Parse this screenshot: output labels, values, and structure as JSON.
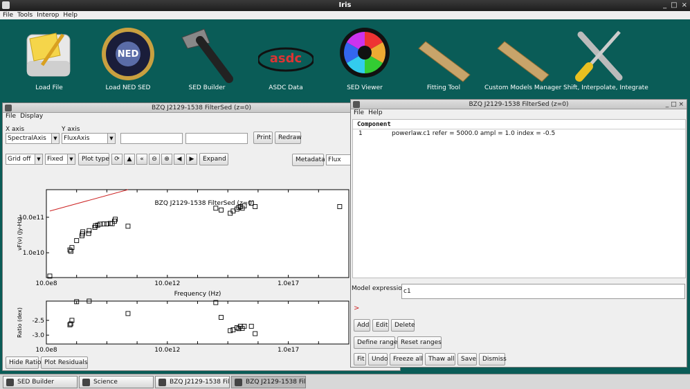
{
  "app": {
    "title": "Iris",
    "menus": [
      "File",
      "Tools",
      "Interop",
      "Help"
    ],
    "win_controls": [
      "_",
      "□",
      "×"
    ]
  },
  "tools": [
    {
      "label": "Load File",
      "icon": "load-file-icon"
    },
    {
      "label": "Load NED SED",
      "icon": "ned-icon"
    },
    {
      "label": "SED Builder",
      "icon": "hammer-icon"
    },
    {
      "label": "ASDC Data",
      "icon": "asdc-icon"
    },
    {
      "label": "SED Viewer",
      "icon": "color-wheel-icon"
    },
    {
      "label": "Fitting Tool",
      "icon": "ruler-icon"
    },
    {
      "label": "Custom Models Manager",
      "icon": "ruler-icon"
    },
    {
      "label": "Shift, Interpolate, Integrate",
      "icon": "wrench-screwdriver-icon"
    }
  ],
  "viewer": {
    "title": "BZQ J2129-1538 FilterSed (z=0)",
    "menus": [
      "File",
      "Display"
    ],
    "x_axis_label": "X axis",
    "y_axis_label": "Y axis",
    "x_axis_value": "SpectralAxis",
    "y_axis_value": "FluxAxis",
    "print": "Print",
    "redraw": "Redraw",
    "grid": "Grid off",
    "scale": "Fixed",
    "plot_type": "Plot type",
    "expand": "Expand",
    "metadata": "Metadata",
    "flux_field": "Flux",
    "hide_ratio": "Hide Ratio",
    "plot_residuals": "Plot Residuals"
  },
  "chart_data": [
    {
      "type": "scatter",
      "title": "BZQ J2129-1538 FilterSed (z=0)",
      "xlabel": "Frequency (Hz)",
      "ylabel": "νF(ν) (Jy-Hz)",
      "xscale": "log",
      "yscale": "log",
      "x_tick_labels": [
        "10.0e8",
        "10.0e12",
        "1.0e17"
      ],
      "y_tick_labels": [
        "10.0e11",
        "1.0e10"
      ],
      "xlim": [
        1000000000.0,
        1e+19
      ],
      "ylim": [
        2000000000.0,
        600000000000.0
      ],
      "series": [
        {
          "name": "",
          "marker": "square",
          "color": "#000000",
          "points": [
            [
              1300000000.0,
              2200000000.0
            ],
            [
              6000000000.0,
              12000000000.0
            ],
            [
              6500000000.0,
              11000000000.0
            ],
            [
              7000000000.0,
              14000000000.0
            ],
            [
              10000000000.0,
              22000000000.0
            ],
            [
              15000000000.0,
              30000000000.0
            ],
            [
              15500000000.0,
              34000000000.0
            ],
            [
              16000000000.0,
              39000000000.0
            ],
            [
              25000000000.0,
              35000000000.0
            ],
            [
              26000000000.0,
              42000000000.0
            ],
            [
              40000000000.0,
              52000000000.0
            ],
            [
              42000000000.0,
              58000000000.0
            ],
            [
              50000000000.0,
              60000000000.0
            ],
            [
              60000000000.0,
              64000000000.0
            ],
            [
              80000000000.0,
              65000000000.0
            ],
            [
              100000000000.0,
              65000000000.0
            ],
            [
              130000000000.0,
              67000000000.0
            ],
            [
              150000000000.0,
              66000000000.0
            ],
            [
              180000000000.0,
              78000000000.0
            ],
            [
              190000000000.0,
              88000000000.0
            ],
            [
              500000000000.0,
              56000000000.0
            ],
            [
              400000000000000.0,
              180000000000.0
            ],
            [
              600000000000000.0,
              160000000000.0
            ],
            [
              1200000000000000.0,
              130000000000.0
            ],
            [
              1500000000000000.0,
              150000000000.0
            ],
            [
              2000000000000000.0,
              170000000000.0
            ],
            [
              2300000000000000.0,
              190000000000.0
            ],
            [
              2600000000000000.0,
              200000000000.0
            ],
            [
              3000000000000000.0,
              180000000000.0
            ],
            [
              3500000000000000.0,
              210000000000.0
            ],
            [
              6000000000000000.0,
              250000000000.0
            ],
            [
              8000000000000000.0,
              200000000000.0
            ],
            [
              5e+18,
              200000000000.0
            ]
          ]
        },
        {
          "name": "",
          "type": "line",
          "color": "#cc2222",
          "points": [
            [
              1300000000.0,
              150000000000.0
            ],
            [
              500000000000.0,
              600000000000.0
            ]
          ]
        }
      ]
    },
    {
      "type": "scatter",
      "xlabel": "",
      "ylabel": "Ratio (dex)",
      "xscale": "log",
      "x_tick_labels": [
        "10.0e8",
        "10.0e12",
        "1.0e17"
      ],
      "y_tick_labels": [
        "-2.5",
        "-3.0"
      ],
      "xlim": [
        1000000000.0,
        1e+19
      ],
      "ylim": [
        -3.3,
        -1.85
      ],
      "series": [
        {
          "name": "",
          "marker": "square",
          "color": "#000000",
          "points": [
            [
              6000000000.0,
              -2.65
            ],
            [
              6400000000.0,
              -2.62
            ],
            [
              7000000000.0,
              -2.5
            ],
            [
              10000000000.0,
              -1.87
            ],
            [
              26000000000.0,
              -1.85
            ],
            [
              500000000000.0,
              -2.27
            ],
            [
              400000000000000.0,
              -1.9
            ],
            [
              600000000000000.0,
              -2.4
            ],
            [
              1200000000000000.0,
              -2.85
            ],
            [
              1500000000000000.0,
              -2.82
            ],
            [
              2000000000000000.0,
              -2.75
            ],
            [
              2300000000000000.0,
              -2.78
            ],
            [
              2600000000000000.0,
              -2.7
            ],
            [
              3000000000000000.0,
              -2.77
            ],
            [
              3500000000000000.0,
              -2.7
            ],
            [
              6000000000000000.0,
              -2.7
            ],
            [
              8000000000000000.0,
              -2.95
            ]
          ]
        }
      ]
    }
  ],
  "fit": {
    "title": "BZQ J2129-1538 FilterSed (z=0)",
    "menus": [
      "File",
      "Help"
    ],
    "component_header": "Component",
    "component_row": {
      "id": "1",
      "text": "powerlaw.c1   refer = 5000.0 ampl = 1.0 index = -0.5"
    },
    "model_expression_label": "Model expression",
    "model_expression": "c1",
    "prompt": ">",
    "add": "Add",
    "edit": "Edit",
    "delete": "Delete",
    "define_range": "Define range",
    "reset_ranges": "Reset ranges",
    "fit": "Fit",
    "undo": "Undo",
    "freeze_all": "Freeze all",
    "thaw_all": "Thaw all",
    "save": "Save",
    "dismiss": "Dismiss"
  },
  "taskbar": [
    "SED Builder",
    "Science",
    "BZQ J2129-1538 Fil...",
    "BZQ J2129-1538 Fil..."
  ]
}
